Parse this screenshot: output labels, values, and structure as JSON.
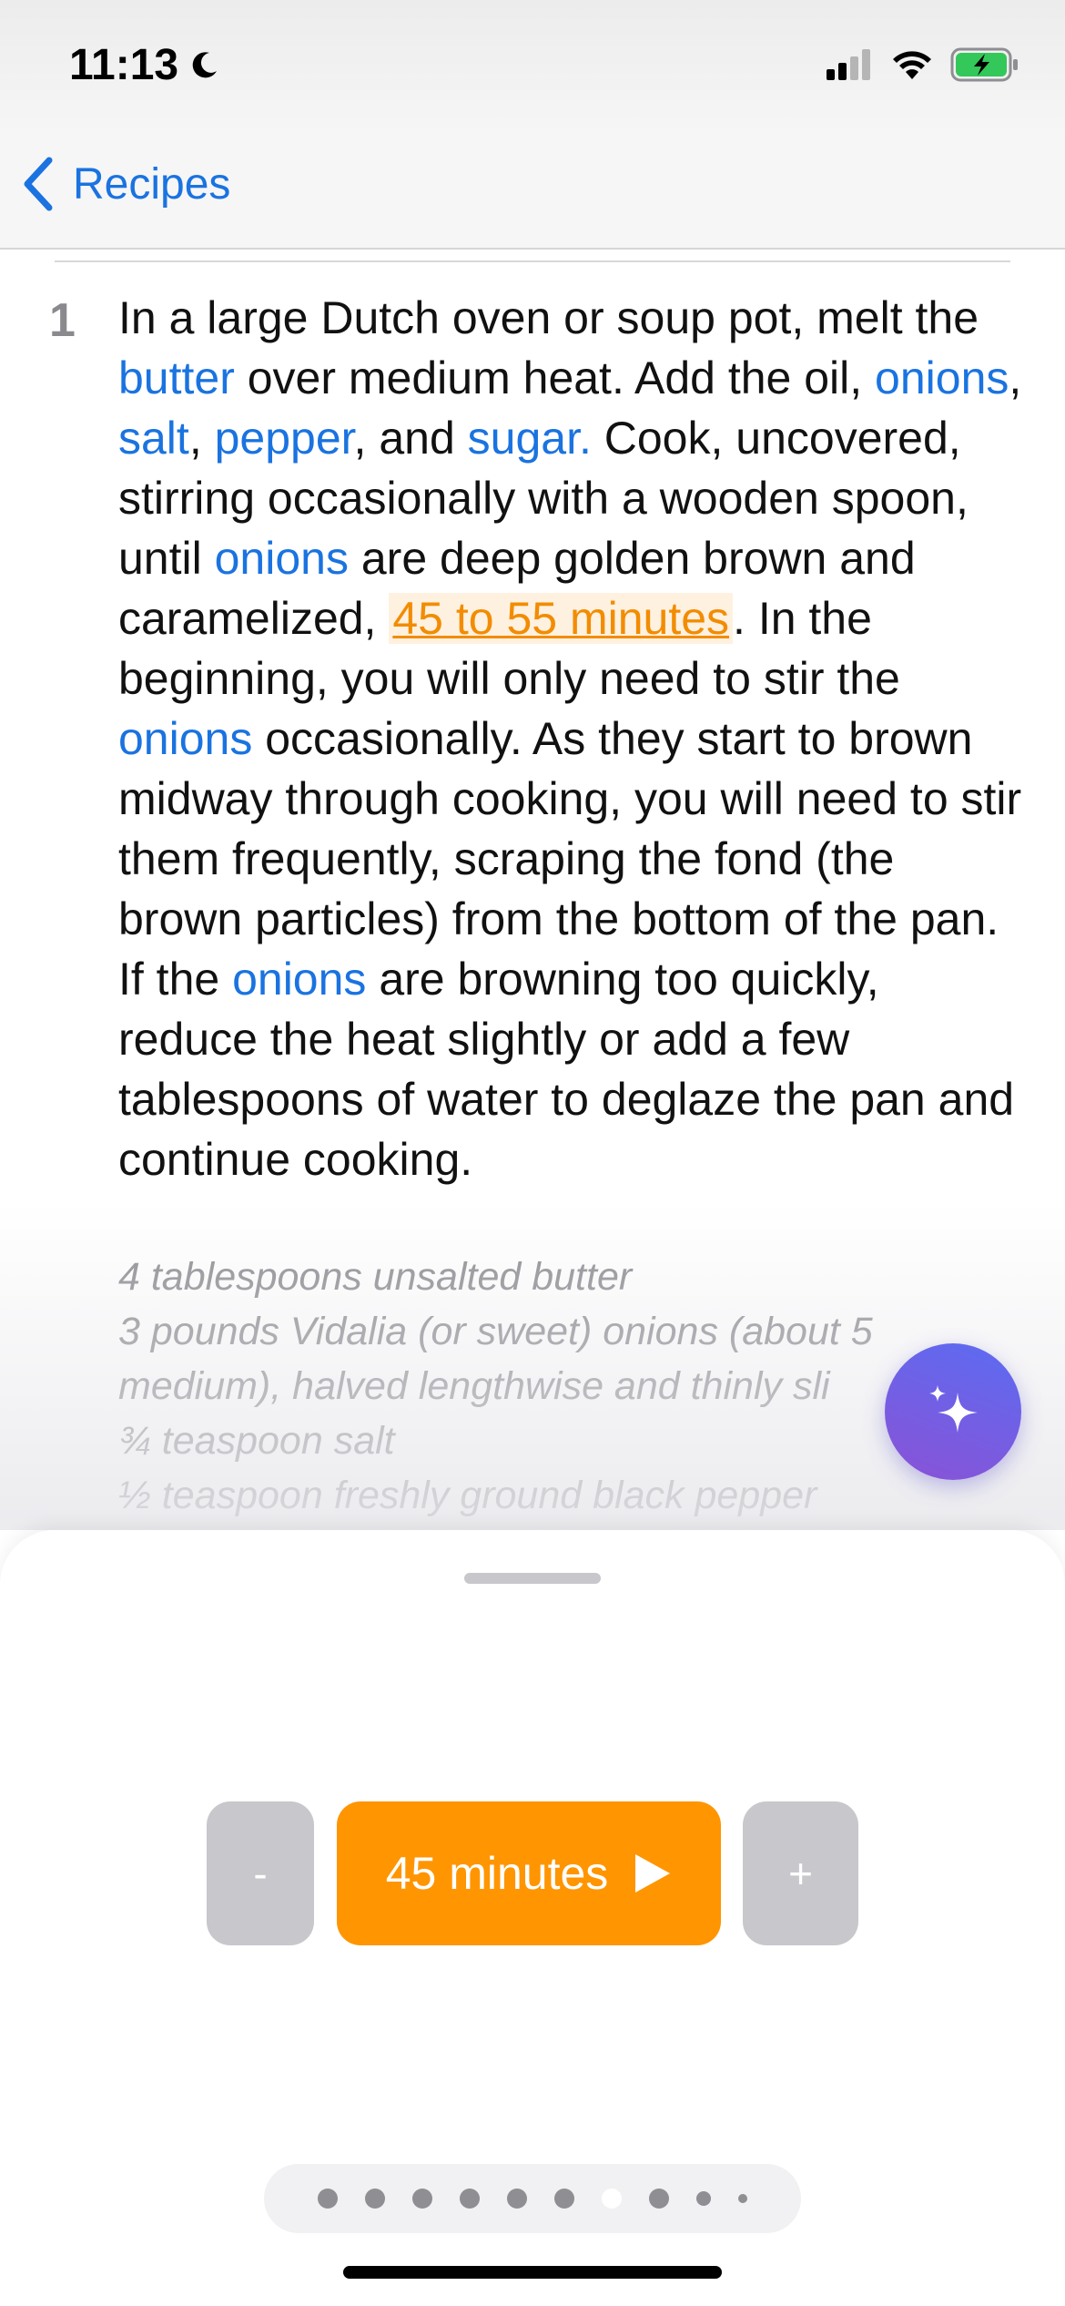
{
  "status_bar": {
    "time": "11:13",
    "icons": [
      "moon-icon",
      "cellular-signal-icon",
      "wifi-icon",
      "battery-charging-icon"
    ]
  },
  "nav": {
    "back_label": "Recipes",
    "back_icon": "chevron-left-icon"
  },
  "step": {
    "number": "1",
    "segments": [
      {
        "text": "In a large Dutch oven or soup pot, melt the ",
        "type": "text"
      },
      {
        "text": "butter",
        "type": "ingredient"
      },
      {
        "text": " over medium heat. Add the oil, ",
        "type": "text"
      },
      {
        "text": "onions",
        "type": "ingredient"
      },
      {
        "text": ", ",
        "type": "text"
      },
      {
        "text": "salt",
        "type": "ingredient"
      },
      {
        "text": ", ",
        "type": "text"
      },
      {
        "text": "pepper",
        "type": "ingredient"
      },
      {
        "text": ", and ",
        "type": "text"
      },
      {
        "text": "sugar.",
        "type": "ingredient"
      },
      {
        "text": " Cook, uncovered, stirring occasionally with a wooden spoon, until ",
        "type": "text"
      },
      {
        "text": "onions",
        "type": "ingredient"
      },
      {
        "text": " are deep golden brown and caramelized, ",
        "type": "text"
      },
      {
        "text": "45 to 55 minutes",
        "type": "timer"
      },
      {
        "text": ". In the beginning, you will only need to stir the ",
        "type": "text"
      },
      {
        "text": "onions",
        "type": "ingredient"
      },
      {
        "text": " occasionally. As they start to brown midway through cooking, you will need to stir them frequently, scraping the fond (the brown particles) from the bottom of the pan. If the ",
        "type": "text"
      },
      {
        "text": "onions",
        "type": "ingredient"
      },
      {
        "text": " are browning too quickly, reduce the heat slightly or add a few tablespoons of water to deglaze the pan and continue cooking.",
        "type": "text"
      }
    ],
    "ingredients": [
      "4 tablespoons unsalted butter",
      "3 pounds Vidalia (or sweet) onions (about 5",
      "medium), halved lengthwise and thinly sli",
      "¾ teaspoon salt",
      "½ teaspoon freshly ground black pepper"
    ]
  },
  "assistant_button": {
    "icon": "sparkles-icon"
  },
  "timer": {
    "minus_label": "-",
    "plus_label": "+",
    "duration_label": "45 minutes",
    "play_icon": "play-icon"
  },
  "pager": {
    "total": 10,
    "active_index": 6
  },
  "colors": {
    "accent_blue": "#1a73e0",
    "timer_orange": "#ff9500",
    "timer_link_orange": "#f28c00",
    "muted_gray": "#8e8e93",
    "ai_gradient_start": "#5b6cf2",
    "ai_gradient_end": "#8a52d6"
  }
}
